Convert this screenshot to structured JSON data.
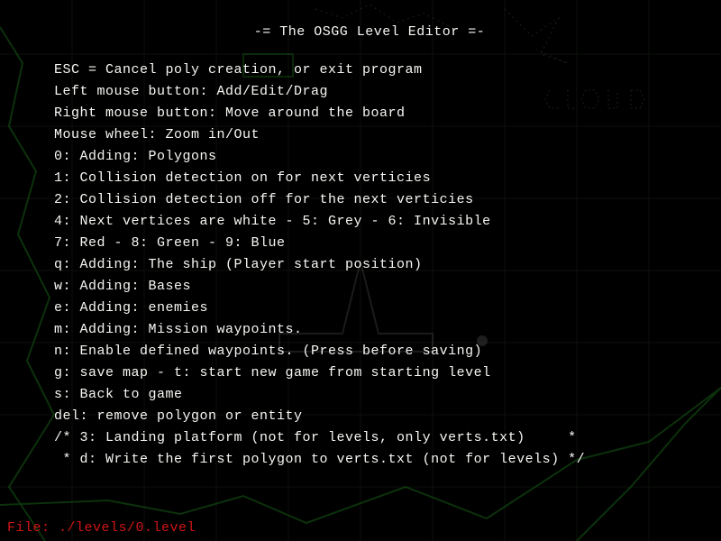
{
  "title": "-= The OSGG Level Editor =-",
  "help_lines": [
    "ESC = Cancel poly creation, or exit program",
    "Left mouse button: Add/Edit/Drag",
    "Right mouse button: Move around the board",
    "Mouse wheel: Zoom in/Out",
    "0: Adding: Polygons",
    "1: Collision detection on for next verticies",
    "2: Collision detection off for the next verticies",
    "4: Next vertices are white - 5: Grey - 6: Invisible",
    "7: Red - 8: Green - 9: Blue",
    "q: Adding: The ship (Player start position)",
    "w: Adding: Bases",
    "e: Adding: enemies",
    "m: Adding: Mission waypoints.",
    "n: Enable defined waypoints. (Press before saving)",
    "g: save map - t: start new game from starting level",
    "s: Back to game",
    "del: remove polygon or entity",
    "/* 3: Landing platform (not for levels, only verts.txt)     *",
    " * d: Write the first polygon to verts.txt (not for levels) */"
  ],
  "status": {
    "file_label": "File: ./levels/0.level"
  },
  "colors": {
    "text": "#f7f7f3",
    "status": "#d11515",
    "bg": "#000000",
    "grid": "#2e3a2e",
    "terrain": "#3fae3f"
  }
}
